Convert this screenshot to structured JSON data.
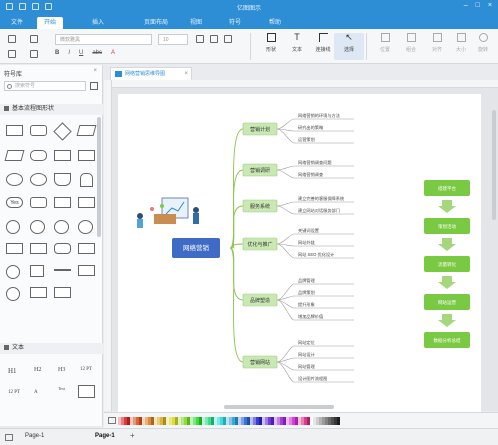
{
  "window": {
    "title": "亿图图示"
  },
  "ribbon": {
    "tabs": [
      {
        "label": "文件"
      },
      {
        "label": "开始"
      },
      {
        "label": "插入"
      },
      {
        "label": "页面布局"
      },
      {
        "label": "视图"
      },
      {
        "label": "符号"
      },
      {
        "label": "帮助"
      }
    ],
    "active_tab": "开始"
  },
  "toolbar": {
    "font_placeholder": "微软雅黑",
    "font_size": "10",
    "format_row": [
      "B",
      "I",
      "U",
      "abc",
      "A"
    ],
    "tools": [
      {
        "label": "形状"
      },
      {
        "label": "文本"
      },
      {
        "label": "连接线"
      },
      {
        "label": "选择"
      },
      {
        "label": "位置"
      },
      {
        "label": "组合"
      },
      {
        "label": "对齐"
      },
      {
        "label": "大小"
      },
      {
        "label": "旋转"
      }
    ]
  },
  "left_panel": {
    "title": "符号库",
    "search_placeholder": "搜索符号",
    "section_shapes": "基本流程图形状",
    "section_text": "文本",
    "text_samples": [
      "H1",
      "H2",
      "H3",
      "12 PT",
      "12 PT",
      "A",
      "Text"
    ]
  },
  "document": {
    "tab_title": "网络营销思维导图"
  },
  "mindmap": {
    "center": "网络营销",
    "branches": [
      {
        "label": "营销计划",
        "leaves": [
          "网络营销的环境与方法",
          "研究出的策略",
          "运营策划"
        ]
      },
      {
        "label": "营销调研",
        "leaves": [
          "网络营销调查问题",
          "网络营销调查"
        ]
      },
      {
        "label": "服务系统",
        "leaves": [
          "建立完善的客服保障系统",
          "建立网站对话服务部门"
        ]
      },
      {
        "label": "优化与推广",
        "leaves": [
          "关键词设置",
          "网站外链",
          "网站 SEO 优化设计"
        ]
      },
      {
        "label": "品牌塑造",
        "leaves": [
          "品牌管理",
          "品牌策划",
          "提升形象",
          "增加品牌价值"
        ]
      },
      {
        "label": "营销网站",
        "leaves": [
          "网站定位",
          "网站设计",
          "网站管理",
          "设计图片流程图"
        ]
      }
    ],
    "flow": [
      "搭建平台",
      "策划活动",
      "流量转化",
      "网站运营",
      "数据分析总结"
    ]
  },
  "status": {
    "page_selector": "Page-1",
    "page_tab": "Page-1",
    "add_page": "+"
  },
  "colors": {
    "accent": "#2d8ed6",
    "center_node": "#3f6bc7",
    "branch_node": "#c9e8b3",
    "flow_node": "#7ac943"
  }
}
